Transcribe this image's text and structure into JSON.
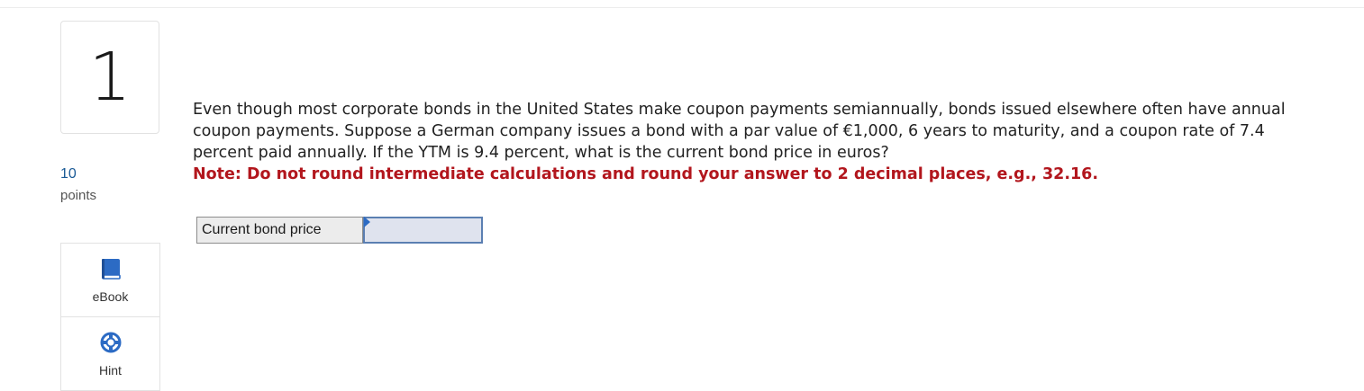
{
  "question": {
    "number": "1",
    "points_value": "10",
    "points_label": "points",
    "text": "Even though most corporate bonds in the United States make coupon payments semiannually, bonds issued elsewhere often have annual coupon payments. Suppose a German company issues a bond with a par value of €1,000, 6 years to maturity, and a coupon rate of 7.4 percent paid annually. If the YTM is 9.4 percent, what is the current bond price in euros?",
    "note": "Note: Do not round intermediate calculations and round your answer to 2 decimal places, e.g., 32.16."
  },
  "tools": {
    "ebook_label": "eBook",
    "hint_label": "Hint"
  },
  "answer": {
    "label": "Current bond price",
    "value": ""
  },
  "colors": {
    "note": "#b2161d",
    "points": "#1a5a96",
    "icon_blue": "#2c6bc4",
    "input_bg": "#dfe3ee"
  }
}
